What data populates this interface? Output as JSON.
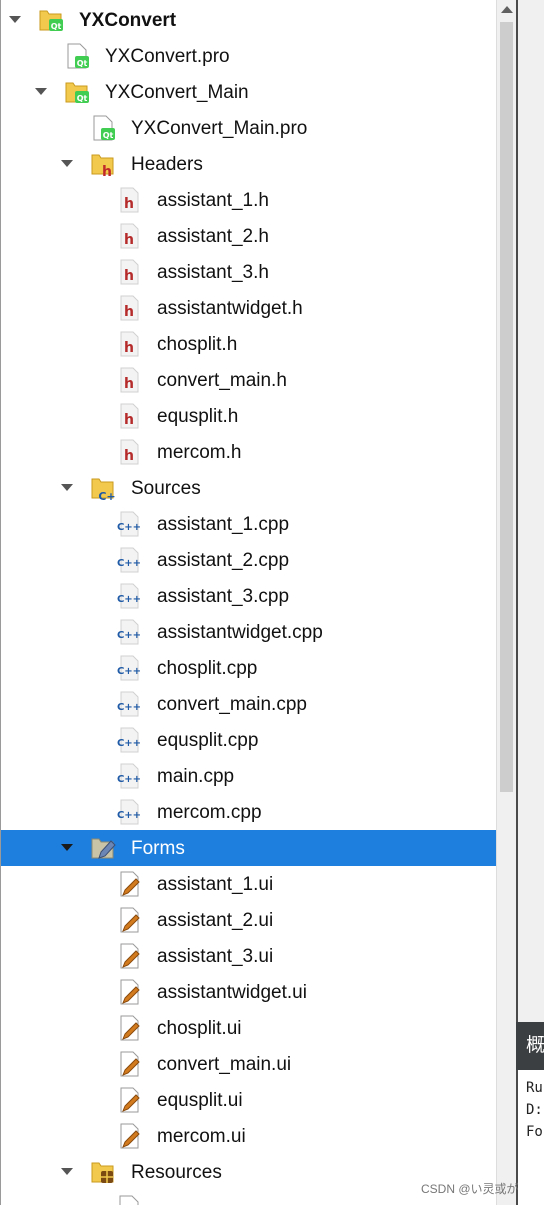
{
  "tree": {
    "root": {
      "label": "YXConvert"
    },
    "root_pro": {
      "label": "YXConvert.pro"
    },
    "main": {
      "label": "YXConvert_Main"
    },
    "main_pro": {
      "label": "YXConvert_Main.pro"
    },
    "headers": {
      "label": "Headers",
      "items": [
        "assistant_1.h",
        "assistant_2.h",
        "assistant_3.h",
        "assistantwidget.h",
        "chosplit.h",
        "convert_main.h",
        "equsplit.h",
        "mercom.h"
      ]
    },
    "sources": {
      "label": "Sources",
      "items": [
        "assistant_1.cpp",
        "assistant_2.cpp",
        "assistant_3.cpp",
        "assistantwidget.cpp",
        "chosplit.cpp",
        "convert_main.cpp",
        "equsplit.cpp",
        "main.cpp",
        "mercom.cpp"
      ]
    },
    "forms": {
      "label": "Forms",
      "selected": true,
      "items": [
        "assistant_1.ui",
        "assistant_2.ui",
        "assistant_3.ui",
        "assistantwidget.ui",
        "chosplit.ui",
        "convert_main.ui",
        "equsplit.ui",
        "mercom.ui"
      ]
    },
    "resources": {
      "label": "Resources"
    }
  },
  "right_pane": {
    "header_text": "概",
    "lines": [
      "Ru",
      "D:",
      "Fo"
    ]
  },
  "watermark": "CSDN @い灵或が",
  "colors": {
    "selection": "#1e7fdf",
    "header_icon": "#b52a2a",
    "cpp_icon": "#1f5aa6",
    "qt_green": "#41cd52",
    "folder": "#f2c94c"
  },
  "icons": {
    "project": "qt-project-folder-icon",
    "pro": "qt-pro-file-icon",
    "headers_folder": "headers-folder-icon",
    "header": "header-file-icon",
    "sources_folder": "sources-folder-icon",
    "cpp": "cpp-file-icon",
    "forms_folder": "forms-folder-icon",
    "ui": "ui-form-file-icon",
    "resources_folder": "resources-folder-icon"
  }
}
